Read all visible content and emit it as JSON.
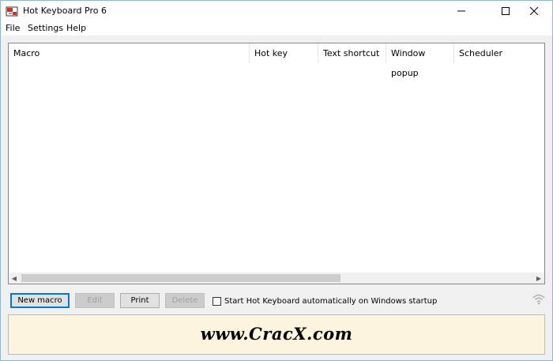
{
  "window": {
    "title": "Hot Keyboard Pro 6",
    "controls": {
      "minimize_icon": "minimize-icon",
      "maximize_icon": "maximize-icon",
      "close_icon": "close-icon"
    }
  },
  "menu": {
    "items": [
      {
        "label": "File"
      },
      {
        "label": "Settings"
      },
      {
        "label": "Help"
      }
    ]
  },
  "macro_list": {
    "columns": [
      {
        "label": "Macro"
      },
      {
        "label": "Hot key"
      },
      {
        "label": "Text shortcut"
      },
      {
        "label": "Window popup"
      },
      {
        "label": "Scheduler"
      }
    ],
    "rows": []
  },
  "actions": {
    "new_macro": "New macro",
    "edit": "Edit",
    "print": "Print",
    "delete": "Delete"
  },
  "startup_option": {
    "label": "Start Hot Keyboard automatically on Windows startup",
    "checked": false
  },
  "banner": {
    "text": "www.CracX.com"
  },
  "colors": {
    "accent": "#0078d7",
    "banner_bg": "#fdf4dd",
    "app_icon_red": "#c0392b"
  }
}
